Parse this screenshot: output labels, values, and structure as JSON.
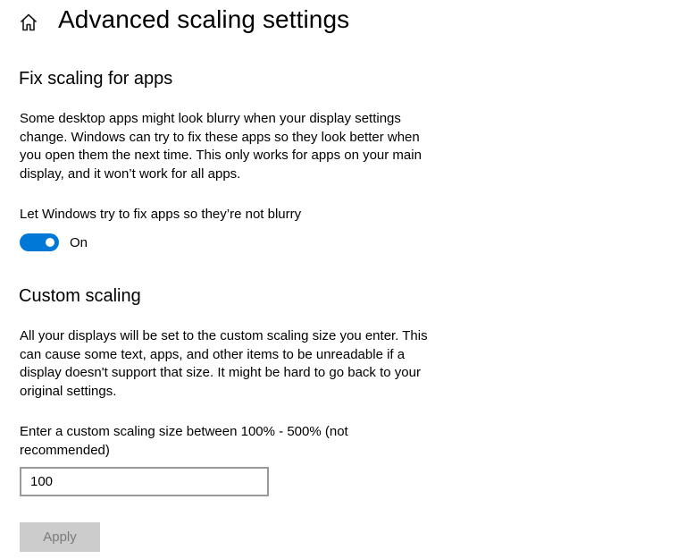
{
  "header": {
    "home_icon": "home-icon",
    "title": "Advanced scaling settings"
  },
  "fix_scaling": {
    "title": "Fix scaling for apps",
    "description": "Some desktop apps might look blurry when your display settings change. Windows can try to fix these apps so they look better when you open them the next time. This only works for apps on your main display, and it won’t work for all apps.",
    "toggle_label": "Let Windows try to fix apps so they’re not blurry",
    "toggle_state": "On",
    "toggle_on": true
  },
  "custom_scaling": {
    "title": "Custom scaling",
    "description": "All your displays will be set to the custom scaling size you enter. This can cause some text, apps, and other items to be unreadable if a display doesn't support that size. It might be hard to go back to your original settings.",
    "input_label": "Enter a custom scaling size between 100% - 500% (not recommended)",
    "input_value": "100",
    "apply_label": "Apply",
    "apply_enabled": false
  },
  "colors": {
    "accent": "#0078d7",
    "button_disabled_bg": "#cccccc",
    "button_disabled_text": "#7a7a7a",
    "input_border": "#999999"
  }
}
